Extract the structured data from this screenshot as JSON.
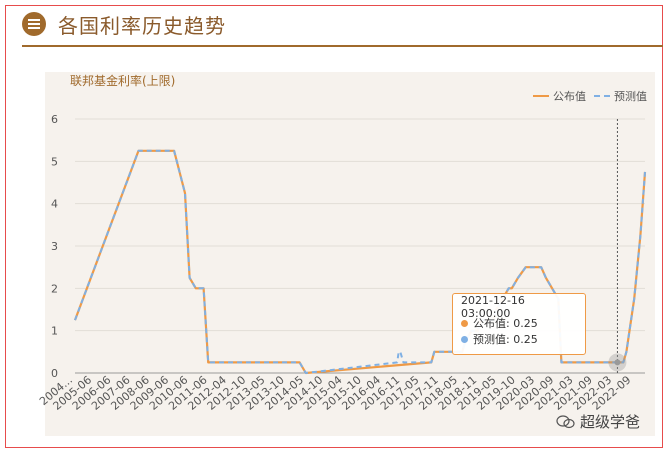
{
  "header": {
    "title": "各国利率历史趋势"
  },
  "watermark": {
    "text": "超级学爸"
  },
  "colors": {
    "published": "#ef9a46",
    "forecast": "#7fb0e4",
    "accent": "#a06a2c",
    "frame": "#e74c4c"
  },
  "tooltip": {
    "time": "2021-12-16 03:00:00",
    "published_label": "公布值: 0.25",
    "forecast_label": "预测值: 0.25"
  },
  "chart_data": {
    "type": "line",
    "ylabel": "联邦基金利率(上限)",
    "ylim": [
      0,
      6
    ],
    "yticks": [
      0,
      1,
      2,
      3,
      4,
      5,
      6
    ],
    "legend": [
      "公布值",
      "预测值"
    ],
    "legend_position": "top-right",
    "x_tick_labels": [
      "2004...",
      "2005-06",
      "2006-06",
      "2007-06",
      "2008-06",
      "2009-06",
      "2010-06",
      "2011-06",
      "2012-04",
      "2012-10",
      "2013-05",
      "2013-10",
      "2014-05",
      "2014-10",
      "2015-04",
      "2015-10",
      "2016-04",
      "2016-11",
      "2017-05",
      "2017-11",
      "2018-05",
      "2018-11",
      "2019-05",
      "2019-10",
      "2020-03",
      "2020-09",
      "2021-03",
      "2021-09",
      "2022-03",
      "2022-09"
    ],
    "x_range": [
      2004.45,
      2022.85
    ],
    "series": [
      {
        "name": "公布值",
        "x": [
          2004.45,
          2006.5,
          2007.65,
          2008.0,
          2008.15,
          2008.35,
          2008.6,
          2008.75,
          2011.7,
          2011.9,
          2015.95,
          2016.05,
          2016.95,
          2017.05,
          2017.25,
          2017.45,
          2017.55,
          2017.95,
          2018.05,
          2018.25,
          2018.45,
          2018.55,
          2018.75,
          2019.0,
          2019.5,
          2019.65,
          2019.85,
          2020.05,
          2020.15,
          2022.15,
          2022.25,
          2022.35,
          2022.5,
          2022.7,
          2022.85
        ],
        "y": [
          1.25,
          5.25,
          5.25,
          4.25,
          2.25,
          2.0,
          2.0,
          0.25,
          0.25,
          0.0,
          0.25,
          0.5,
          0.5,
          0.75,
          1.0,
          1.0,
          1.25,
          1.25,
          1.5,
          1.75,
          2.0,
          2.0,
          2.25,
          2.5,
          2.5,
          2.25,
          2.0,
          1.75,
          0.25,
          0.25,
          0.5,
          1.0,
          1.75,
          3.25,
          4.75
        ]
      },
      {
        "name": "预测值",
        "x": [
          2004.45,
          2006.5,
          2007.65,
          2008.0,
          2008.15,
          2008.35,
          2008.6,
          2008.75,
          2011.7,
          2011.9,
          2014.85,
          2014.9,
          2014.95,
          2015.05,
          2015.1,
          2015.95,
          2016.05,
          2016.95,
          2017.05,
          2017.25,
          2017.45,
          2017.55,
          2017.95,
          2018.05,
          2018.25,
          2018.45,
          2018.55,
          2018.75,
          2019.0,
          2019.5,
          2019.65,
          2019.85,
          2020.05,
          2020.15,
          2022.15,
          2022.25,
          2022.35,
          2022.5,
          2022.7,
          2022.85
        ],
        "y": [
          1.25,
          5.25,
          5.25,
          4.25,
          2.25,
          2.0,
          2.0,
          0.25,
          0.25,
          0.0,
          0.25,
          0.5,
          0.5,
          0.25,
          0.25,
          0.25,
          0.5,
          0.5,
          0.75,
          1.0,
          1.0,
          1.25,
          1.25,
          1.5,
          1.75,
          2.0,
          2.0,
          2.25,
          2.5,
          2.5,
          2.25,
          2.0,
          1.75,
          0.25,
          0.25,
          0.5,
          1.0,
          1.75,
          3.25,
          4.75
        ]
      }
    ],
    "highlight": {
      "x": 2021.96,
      "y": 0.25
    }
  }
}
